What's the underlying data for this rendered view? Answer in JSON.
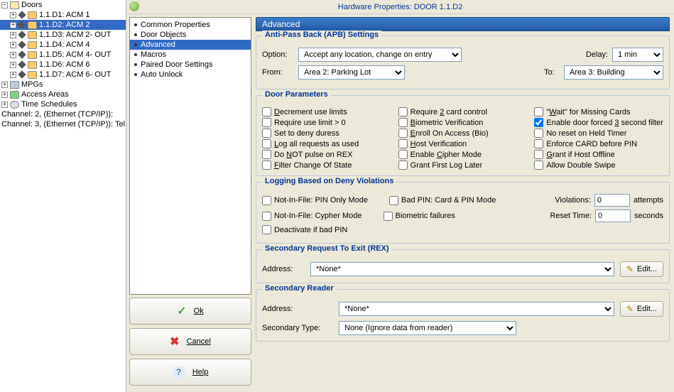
{
  "window_title": "Hardware Properties: DOOR 1.1.D2",
  "tree": {
    "root": "Doors",
    "items": [
      "1.1.D1: ACM 1",
      "1.1.D2: ACM 2",
      "1.1.D3: ACM 2- OUT",
      "1.1.D4: ACM 4",
      "1.1.D5: ACM 4- OUT",
      "1.1.D6: ACM 6",
      "1.1.D7: ACM 6- OUT"
    ],
    "selected_index": 1,
    "siblings": [
      "MPGs",
      "Access Areas",
      "Time Schedules"
    ],
    "channels": [
      "Channel: 2, (Ethernet (TCP/IP)):",
      "Channel: 3, (Ethernet (TCP/IP)): Tel"
    ]
  },
  "nav": {
    "items": [
      "Common Properties",
      "Door Objects",
      "Advanced",
      "Macros",
      "Paired Door Settings",
      "Auto Unlock"
    ],
    "selected_index": 2
  },
  "buttons": {
    "ok": "Ok",
    "cancel": "Cancel",
    "help": "Help"
  },
  "section_header": "Advanced",
  "apb": {
    "title": "Anti-Pass Back (APB) Settings",
    "option_label": "Option:",
    "option_value": "Accept any location, change on entry",
    "delay_label": "Delay:",
    "delay_value": "1 min",
    "from_label": "From:",
    "from_value": "Area 2: Parking Lot",
    "to_label": "To:",
    "to_value": "Area 3: Building"
  },
  "door_params": {
    "title": "Door Parameters",
    "rows": [
      [
        "Decrement use limits",
        "Require 2 card control",
        "\"Wait\" for Missing Cards"
      ],
      [
        "Require use limit > 0",
        "Biometric Verification",
        "Enable door forced 3 second filter"
      ],
      [
        "Set to deny duress",
        "Enroll On Access (Bio)",
        "No reset on Held Timer"
      ],
      [
        "Log all requests as used",
        "Host Verification",
        "Enforce CARD before PIN"
      ],
      [
        "Do NOT pulse on REX",
        "Enable Cipher Mode",
        "Grant if Host Offline"
      ],
      [
        "Filter Change Of State",
        "Grant First Log Later",
        "Allow Double Swipe"
      ]
    ],
    "checked": {
      "row": 1,
      "col": 2
    }
  },
  "logging": {
    "title": "Logging Based on Deny Violations",
    "row1": [
      "Not-In-File: PIN Only Mode",
      "Bad PIN: Card & PIN Mode"
    ],
    "row2": [
      "Not-In-File: Cypher Mode",
      "Biometric failures"
    ],
    "row3": "Deactivate if bad PIN",
    "violations_label": "Violations:",
    "violations_value": "0",
    "violations_unit": "attempts",
    "reset_label": "Reset Time:",
    "reset_value": "0",
    "reset_unit": "seconds"
  },
  "rex": {
    "title": "Secondary Request To Exit (REX)",
    "address_label": "Address:",
    "address_value": "*None*",
    "edit": "Edit..."
  },
  "reader": {
    "title": "Secondary Reader",
    "address_label": "Address:",
    "address_value": "*None*",
    "sectype_label": "Secondary Type:",
    "sectype_value": "None (Ignore data from reader)",
    "edit": "Edit..."
  }
}
